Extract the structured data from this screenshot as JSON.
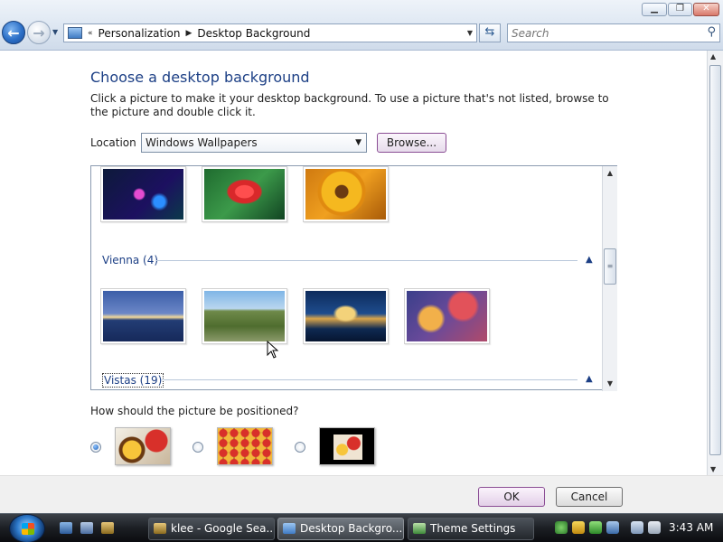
{
  "breadcrumb": {
    "overflow": "«",
    "items": [
      "Personalization",
      "Desktop Background"
    ]
  },
  "search": {
    "placeholder": "Search"
  },
  "main": {
    "title": "Choose a desktop background",
    "description": "Click a picture to make it your desktop background. To use a picture that's not listed, browse to the picture and double click it.",
    "location_label": "Location",
    "location_value": "Windows Wallpapers",
    "browse_label": "Browse..."
  },
  "gallery": {
    "groups": [
      {
        "name": "Vienna (4)"
      },
      {
        "name": "Vistas (19)"
      }
    ]
  },
  "position": {
    "question": "How should the picture be positioned?",
    "options": [
      "fill",
      "tile",
      "center"
    ],
    "selected": "fill"
  },
  "buttons": {
    "ok": "OK",
    "cancel": "Cancel"
  },
  "taskbar": {
    "tasks": [
      "klee - Google Sea...",
      "Desktop Backgro...",
      "Theme Settings"
    ],
    "clock": "3:43 AM"
  },
  "colors": {
    "link_blue": "#1c3f85",
    "accent_purple": "#8a4d94"
  }
}
